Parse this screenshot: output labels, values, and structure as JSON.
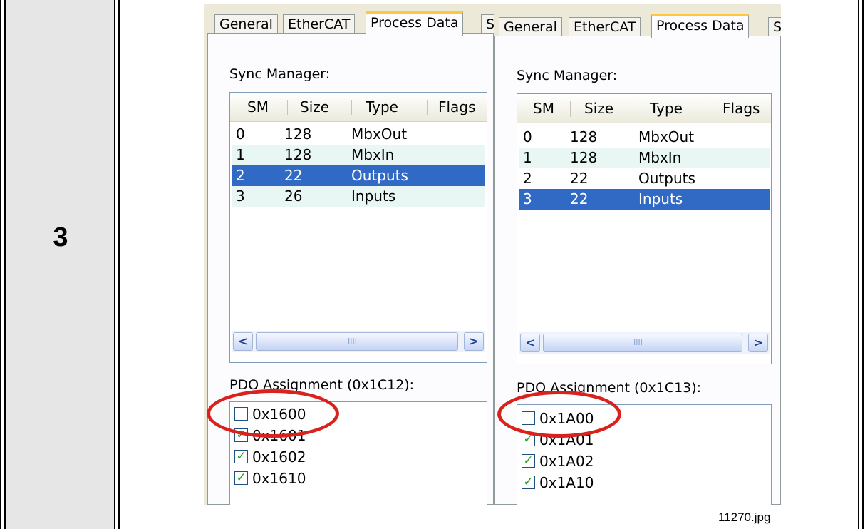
{
  "step": {
    "number": "3"
  },
  "panels": [
    {
      "tabs": [
        "General",
        "EtherCAT",
        "Process Data",
        "S"
      ],
      "active_tab": "Process Data",
      "sync_manager_label": "Sync Manager:",
      "columns": [
        "SM",
        "Size",
        "Type",
        "Flags"
      ],
      "rows": [
        {
          "sm": "0",
          "size": "128",
          "type": "MbxOut",
          "selected": false
        },
        {
          "sm": "1",
          "size": "128",
          "type": "MbxIn",
          "selected": false
        },
        {
          "sm": "2",
          "size": "22",
          "type": "Outputs",
          "selected": true
        },
        {
          "sm": "3",
          "size": "26",
          "type": "Inputs",
          "selected": false
        }
      ],
      "pdo_label": "PDO Assignment (0x1C12):",
      "pdo_items": [
        {
          "label": "0x1600",
          "checked": false
        },
        {
          "label": "0x1601",
          "checked": true
        },
        {
          "label": "0x1602",
          "checked": true
        },
        {
          "label": "0x1610",
          "checked": true
        }
      ]
    },
    {
      "tabs": [
        "General",
        "EtherCAT",
        "Process Data",
        "S"
      ],
      "active_tab": "Process Data",
      "sync_manager_label": "Sync Manager:",
      "columns": [
        "SM",
        "Size",
        "Type",
        "Flags"
      ],
      "rows": [
        {
          "sm": "0",
          "size": "128",
          "type": "MbxOut",
          "selected": false
        },
        {
          "sm": "1",
          "size": "128",
          "type": "MbxIn",
          "selected": false
        },
        {
          "sm": "2",
          "size": "22",
          "type": "Outputs",
          "selected": false
        },
        {
          "sm": "3",
          "size": "22",
          "type": "Inputs",
          "selected": true
        }
      ],
      "pdo_label": "PDO Assignment (0x1C13):",
      "pdo_items": [
        {
          "label": "0x1A00",
          "checked": false
        },
        {
          "label": "0x1A01",
          "checked": true
        },
        {
          "label": "0x1A02",
          "checked": true
        },
        {
          "label": "0x1A10",
          "checked": true
        }
      ]
    }
  ],
  "scrollbar": {
    "left_arrow": "<",
    "right_arrow": ">",
    "grip": "IIII"
  },
  "checkmark": "✓",
  "annotation_color": "#d9221e",
  "selection_color": "#316ac5",
  "file_label": "11270.jpg"
}
